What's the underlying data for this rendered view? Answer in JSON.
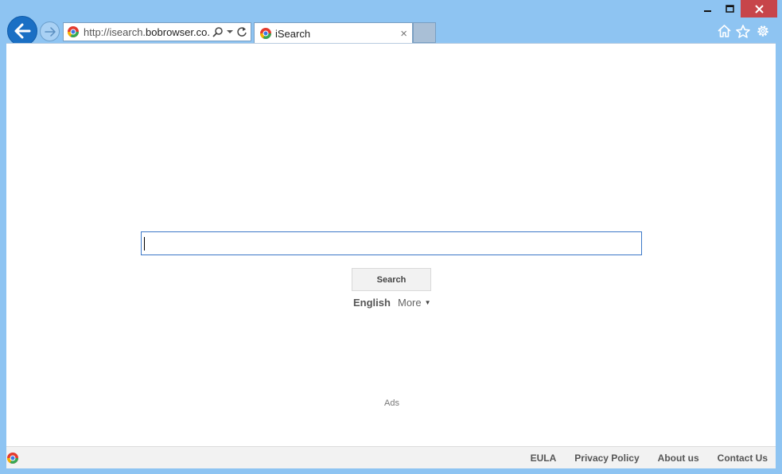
{
  "window": {
    "minimize_glyph": "minimize-icon",
    "maximize_glyph": "maximize-icon",
    "close_glyph": "close-icon"
  },
  "addressbar": {
    "url_prefix": "http://isearch.",
    "url_domain": "bobrowser.co...",
    "icons": [
      "site-favicon",
      "search-icon",
      "dropdown-icon",
      "refresh-icon"
    ]
  },
  "tab": {
    "title": "iSearch",
    "close_label": "×"
  },
  "toolbar_icons": [
    "home-icon",
    "star-icon",
    "gear-icon"
  ],
  "page": {
    "search_input_value": "",
    "search_button": "Search",
    "language": "English",
    "more_label": "More",
    "ads_label": "Ads"
  },
  "footer": {
    "links": [
      "EULA",
      "Privacy Policy",
      "About us",
      "Contact Us"
    ]
  },
  "colors": {
    "frame": "#8ec4f2",
    "close_button": "#c7454a",
    "back_button": "#1a6fc4",
    "input_border": "#3c78c8"
  }
}
